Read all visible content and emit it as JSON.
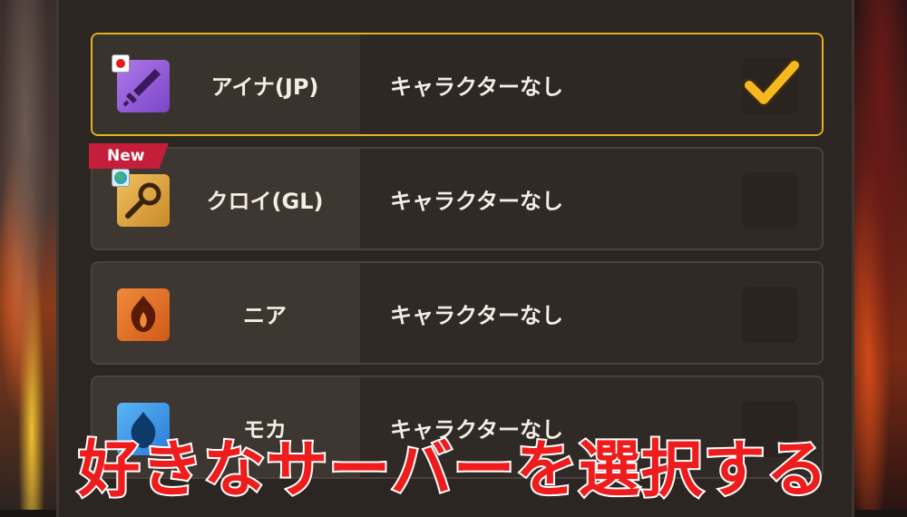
{
  "server_list": {
    "rows": [
      {
        "name": "アイナ(JP)",
        "status": "キャラクターなし",
        "selected": true,
        "flag": "jp",
        "icon": "sword-icon"
      },
      {
        "name": "クロイ(GL)",
        "status": "キャラクターなし",
        "selected": false,
        "flag": "gl",
        "icon": "staff-icon",
        "badge": "New"
      },
      {
        "name": "ニア",
        "status": "キャラクターなし",
        "selected": false,
        "icon": "fire-icon"
      },
      {
        "name": "モカ",
        "status": "キャラクターなし",
        "selected": false,
        "icon": "water-flame-icon"
      }
    ]
  },
  "caption": "好きなサーバーを選択する",
  "colors": {
    "selected_border": "#e6b020",
    "checkmark": "#f5b820",
    "new_badge": "#c41e3a",
    "caption_text": "#ee1c1c"
  }
}
